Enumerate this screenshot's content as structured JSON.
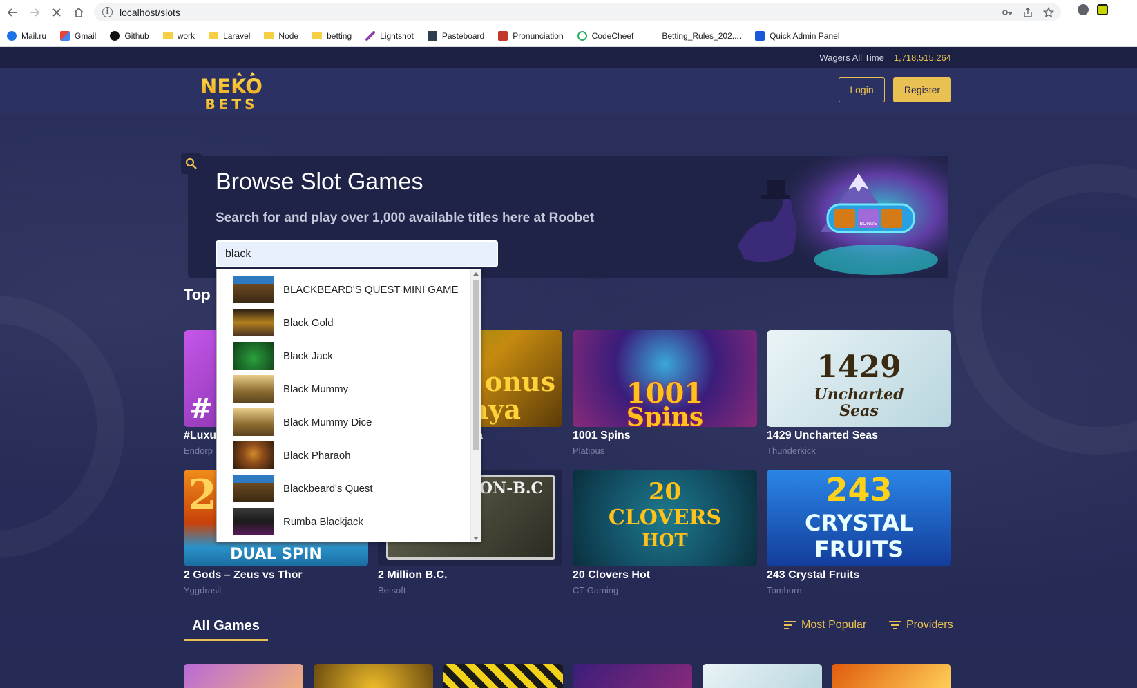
{
  "browser": {
    "url": "localhost/slots",
    "bookmarks": [
      {
        "label": "Mail.ru",
        "icon": "mailru-icon",
        "color": "#1a73e8"
      },
      {
        "label": "Gmail",
        "icon": "gmail-icon",
        "color": "#ea4335"
      },
      {
        "label": "Github",
        "icon": "github-icon",
        "color": "#111111"
      },
      {
        "label": "work",
        "icon": "folder-icon",
        "color": "#f6cf45"
      },
      {
        "label": "Laravel",
        "icon": "folder-icon",
        "color": "#f6cf45"
      },
      {
        "label": "Node",
        "icon": "folder-icon",
        "color": "#f6cf45"
      },
      {
        "label": "betting",
        "icon": "folder-icon",
        "color": "#f6cf45"
      },
      {
        "label": "Lightshot",
        "icon": "lightshot-icon",
        "color": "#8e44ad"
      },
      {
        "label": "Pasteboard",
        "icon": "pasteboard-icon",
        "color": "#2c3e50"
      },
      {
        "label": "Pronunciation",
        "icon": "pronunciation-icon",
        "color": "#c0392b"
      },
      {
        "label": "CodeCheef",
        "icon": "codecheef-icon",
        "color": "#27ae60"
      },
      {
        "label": "Betting_Rules_202....",
        "icon": "blank-page-icon",
        "color": "#ffffff"
      },
      {
        "label": "Quick Admin Panel",
        "icon": "qap-icon",
        "color": "#1a57d6"
      }
    ]
  },
  "site": {
    "wagers_label": "Wagers All Time",
    "wagers_value": "1,718,515,264",
    "logo_line1": "NEKO",
    "logo_line2": "BETS",
    "login_label": "Login",
    "register_label": "Register"
  },
  "hero": {
    "title": "Browse Slot Games",
    "subtitle": "Search for and play over 1,000 available titles here at Roobet",
    "search_value": "black",
    "art_bonus": "BONUS"
  },
  "top_section": {
    "title_visible": "Top",
    "games": [
      {
        "name": "#Luxu",
        "provider": "Endorp",
        "colors": [
          "#b43cd8",
          "#5a1a80"
        ]
      },
      {
        "name": "a",
        "provider": "",
        "colors": [
          "#c58a10",
          "#5c3b08"
        ]
      },
      {
        "name": "1001 Spins",
        "provider": "Platipus",
        "colors": [
          "#3a1d7a",
          "#8a2a7a"
        ],
        "art": "1001 Spins"
      },
      {
        "name": "1429 Uncharted Seas",
        "provider": "Thunderkick",
        "colors": [
          "#e4f1f4",
          "#b9d6df"
        ],
        "art": "1429 Uncharted Seas"
      },
      {
        "name": "2 Gods – Zeus vs Thor",
        "provider": "Yggdrasil",
        "colors": [
          "#e05a0c",
          "#2a92c9"
        ],
        "art": "DUAL SPIN"
      },
      {
        "name": "2 Million B.C.",
        "provider": "Betsoft",
        "colors": [
          "#5a5a4a",
          "#2b2b22"
        ],
        "art": "ON-B.C"
      },
      {
        "name": "20 Clovers Hot",
        "provider": "CT Gaming",
        "colors": [
          "#14546a",
          "#0a2f3c"
        ],
        "art": "20 CLOVERS HOT"
      },
      {
        "name": "243 Crystal Fruits",
        "provider": "Tomhorn",
        "colors": [
          "#1f6fd6",
          "#133d9c"
        ],
        "art": "243 CRYSTAL FRUITS"
      }
    ]
  },
  "tabs": {
    "all_games": "All Games",
    "most_popular": "Most Popular",
    "providers": "Providers"
  },
  "dropdown": {
    "items": [
      {
        "label": "BLACKBEARD'S QUEST MINI GAME",
        "colors": [
          "#2d7ac0",
          "#6b4a22"
        ]
      },
      {
        "label": "Black Gold",
        "colors": [
          "#4a3222",
          "#b3801e"
        ]
      },
      {
        "label": "Black Jack",
        "colors": [
          "#1f7a2c",
          "#0f3d17"
        ]
      },
      {
        "label": "Black Mummy",
        "colors": [
          "#d1b06a",
          "#5a4420"
        ]
      },
      {
        "label": "Black Mummy Dice",
        "colors": [
          "#d1b06a",
          "#5a4420"
        ]
      },
      {
        "label": "Black Pharaoh",
        "colors": [
          "#8a4a1a",
          "#2a1a0a"
        ]
      },
      {
        "label": "Blackbeard's Quest",
        "colors": [
          "#2d7ac0",
          "#6b4a22"
        ]
      },
      {
        "label": "Rumba Blackjack",
        "colors": [
          "#2a2a2a",
          "#5a1a5a"
        ]
      }
    ]
  }
}
